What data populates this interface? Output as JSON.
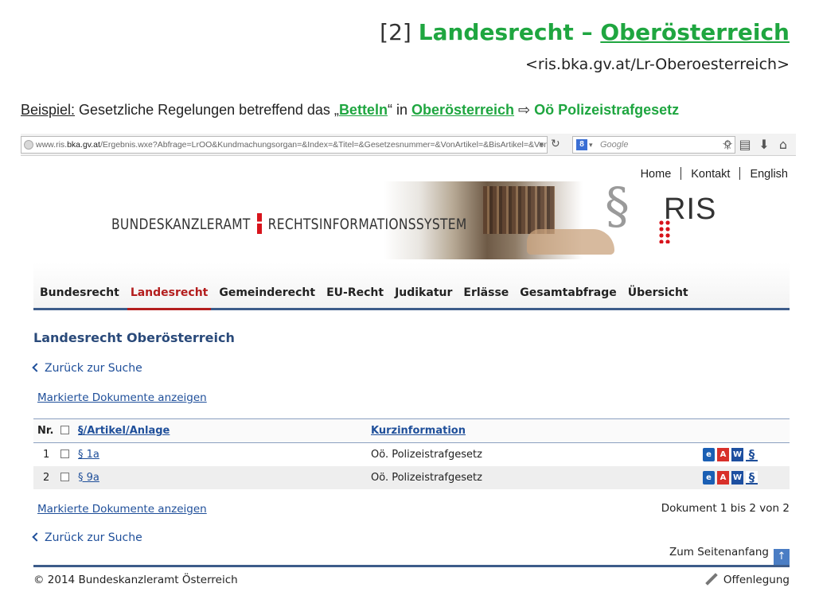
{
  "slide": {
    "title_prefix": "[2] ",
    "title_main": "Landesrecht – ",
    "title_link": "Oberösterreich",
    "url_text": "<ris.bka.gv.at/Lr-Oberoesterreich>",
    "example": {
      "label": "Beispiel:",
      "text1": " Gesetzliche Regelungen betreffend das „",
      "term": "Betteln",
      "text2": "“ in ",
      "region": "Oberösterreich",
      "arrow": " ⇨ ",
      "law": "Oö Polizeistrafgesetz"
    },
    "colors": {
      "green": "#1fa640",
      "nav_accent": "#3d5c8a",
      "active_tab": "#b31d1d",
      "link": "#1f4f9a"
    }
  },
  "browser": {
    "url_prefix": "www.ris.",
    "url_bold": "bka.gv.at",
    "url_rest": "/Ergebnis.wxe?Abfrage=LrOO&Kundmachungsorgan=&Index=&Titel=&Gesetzesnummer=&VonArtikel=&BisArtikel=&VonParagraf=&",
    "search_placeholder": "Google",
    "search_engine_icon": "google-g-icon"
  },
  "site": {
    "top_links": [
      "Home",
      "Kontakt",
      "English"
    ],
    "banner": {
      "org_left": "BUNDESKANZLERAMT",
      "org_right": "RECHTSINFORMATIONSSYSTEM",
      "paragraph_sign": "§",
      "logo_text": "RIS"
    },
    "nav_tabs": [
      "Bundesrecht",
      "Landesrecht",
      "Gemeinderecht",
      "EU-Recht",
      "Judikatur",
      "Erlässe",
      "Gesamtabfrage",
      "Übersicht"
    ],
    "active_tab": "Landesrecht",
    "page_title": "Landesrecht Oberösterreich",
    "back_link": "Zurück zur Suche",
    "marked_docs_link": "Markierte Dokumente anzeigen",
    "table": {
      "headers": {
        "nr": "Nr.",
        "article": "§/Artikel/Anlage",
        "info": "Kurzinformation"
      },
      "rows": [
        {
          "nr": "1",
          "article": "§ 1a",
          "info": "Oö. Polizeistrafgesetz"
        },
        {
          "nr": "2",
          "article": "§ 9a",
          "info": "Oö. Polizeistrafgesetz"
        }
      ]
    },
    "doc_count": "Dokument 1 bis 2 von 2",
    "to_top": "Zum Seitenanfang",
    "copyright": "© 2014 Bundeskanzleramt Österreich",
    "offenlegung": "Offenlegung"
  }
}
